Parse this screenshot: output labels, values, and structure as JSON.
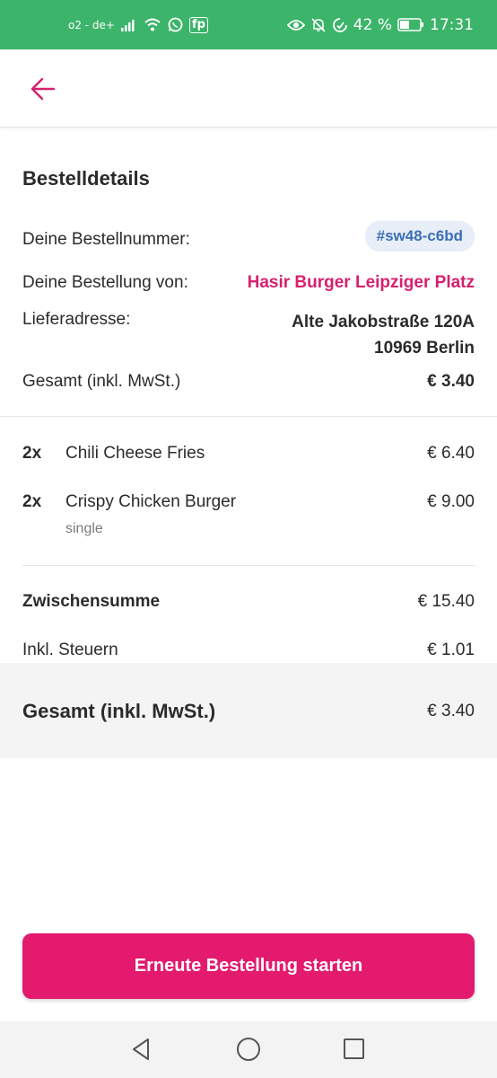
{
  "status_bar": {
    "carrier": "o2 - de+",
    "fp_label": "fp",
    "battery_percent": "42 %",
    "time": "17:31",
    "background_color": "#3cb46a",
    "icons": [
      "signal-icon",
      "wifi-icon",
      "whatsapp-icon",
      "eye-icon",
      "bell-off-icon",
      "data-saver-icon",
      "battery-icon"
    ]
  },
  "app_bar": {
    "back_icon": "arrow-left-icon",
    "accent_color": "#d7206e"
  },
  "order": {
    "title": "Bestelldetails",
    "number_label": "Deine Bestellnummer:",
    "number_value": "#sw48-c6bd",
    "from_label": "Deine Bestellung von:",
    "from_value": "Hasir Burger Leipziger Platz",
    "address_label": "Lieferadresse:",
    "address_line1": "Alte Jakobstraße 120A",
    "address_line2": "10969 Berlin",
    "total_label": "Gesamt (inkl. MwSt.)",
    "total_value": "€ 3.40"
  },
  "items": [
    {
      "qty": "2x",
      "name": "Chili Cheese Fries",
      "price": "€ 6.40",
      "note": ""
    },
    {
      "qty": "2x",
      "name": "Crispy Chicken Burger",
      "price": "€ 9.00",
      "note": "single"
    }
  ],
  "summary": {
    "subtotal_label": "Zwischensumme",
    "subtotal_value": "€ 15.40",
    "tax_label": "Inkl. Steuern",
    "tax_value": "€ 1.01",
    "grand_total_label": "Gesamt (inkl. MwSt.)",
    "grand_total_value": "€ 3.40"
  },
  "cta": {
    "label": "Erneute Bestellung starten",
    "color": "#e31a6e"
  },
  "nav_bar": {
    "icons": [
      "back-triangle-icon",
      "home-circle-icon",
      "recents-square-icon"
    ]
  }
}
